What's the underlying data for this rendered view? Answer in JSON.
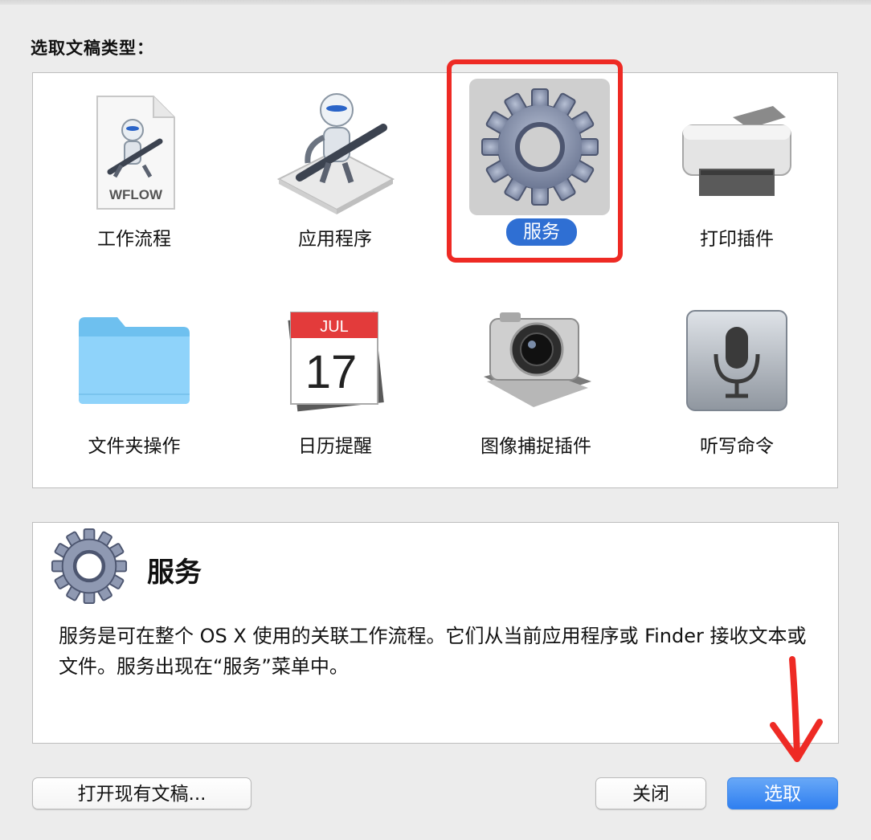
{
  "dialog": {
    "heading": "选取文稿类型："
  },
  "doc_types": [
    {
      "label": "工作流程",
      "icon": "workflow-file-icon",
      "icon_text": "WFLOW",
      "selected": false
    },
    {
      "label": "应用程序",
      "icon": "automator-robot-icon",
      "selected": false
    },
    {
      "label": "服务",
      "icon": "gear-icon",
      "selected": true
    },
    {
      "label": "打印插件",
      "icon": "printer-icon",
      "selected": false
    },
    {
      "label": "文件夹操作",
      "icon": "folder-icon",
      "selected": false
    },
    {
      "label": "日历提醒",
      "icon": "calendar-icon",
      "icon_month": "JUL",
      "icon_day": "17",
      "selected": false
    },
    {
      "label": "图像捕捉插件",
      "icon": "camera-icon",
      "selected": false
    },
    {
      "label": "听写命令",
      "icon": "microphone-icon",
      "selected": false
    }
  ],
  "description": {
    "title": "服务",
    "text": "服务是可在整个 OS X 使用的关联工作流程。它们从当前应用程序或 Finder 接收文本或文件。服务出现在“服务”菜单中。",
    "icon": "gear-icon"
  },
  "buttons": {
    "open_existing": "打开现有文稿...",
    "close": "关闭",
    "choose": "选取"
  },
  "annotations": {
    "highlight_color": "#ee2a24",
    "arrow_color": "#ee2a24"
  }
}
